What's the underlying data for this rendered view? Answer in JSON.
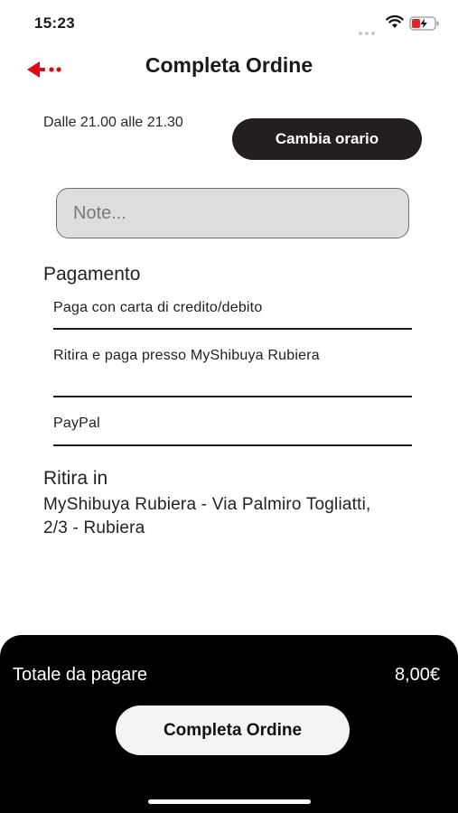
{
  "status_bar": {
    "time": "15:23",
    "icons": [
      "signal-dots-icon",
      "wifi-icon",
      "battery-charging-icon"
    ],
    "battery_color": "#e0262b"
  },
  "header": {
    "title": "Completa Ordine",
    "back_icon": "back-arrow-icon",
    "accent_color": "#e30613"
  },
  "pickup_time": {
    "label": "Dalle 21.00 alle 21.30",
    "change_button_label": "Cambia orario"
  },
  "notes": {
    "placeholder": "Note...",
    "value": ""
  },
  "payment": {
    "title": "Pagamento",
    "options": [
      {
        "label": "Paga con carta di credito/debito"
      },
      {
        "label": "Ritira e paga presso MyShibuya Rubiera"
      },
      {
        "label": "PayPal"
      }
    ]
  },
  "pickup_location": {
    "title": "Ritira in",
    "address": "MyShibuya Rubiera - Via Palmiro Togliatti, 2/3 - Rubiera"
  },
  "footer": {
    "total_label": "Totale da pagare",
    "total_value": "8,00€",
    "complete_button_label": "Completa Ordine"
  }
}
